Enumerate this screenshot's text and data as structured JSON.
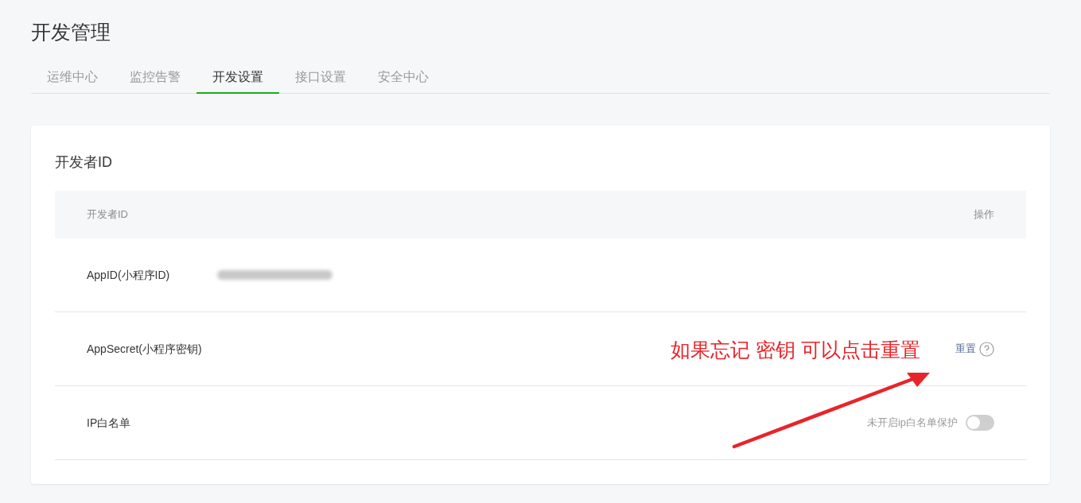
{
  "page_title": "开发管理",
  "tabs": [
    {
      "label": "运维中心",
      "selected": false
    },
    {
      "label": "监控告警",
      "selected": false
    },
    {
      "label": "开发设置",
      "selected": true
    },
    {
      "label": "接口设置",
      "selected": false
    },
    {
      "label": "安全中心",
      "selected": false
    }
  ],
  "card": {
    "title": "开发者ID",
    "columns": [
      "开发者ID",
      "操作"
    ],
    "rows": [
      {
        "kind": "value",
        "label": "AppID(小程序ID)",
        "value_blurred": true
      },
      {
        "kind": "action",
        "label": "AppSecret(小程序密钥)",
        "action": "重置"
      },
      {
        "kind": "toggle",
        "label": "IP白名单",
        "toggle_label": "未开启ip白名单保护",
        "on": false
      }
    ]
  },
  "annotation": {
    "text": "如果忘记 密钥 可以点击重置"
  }
}
